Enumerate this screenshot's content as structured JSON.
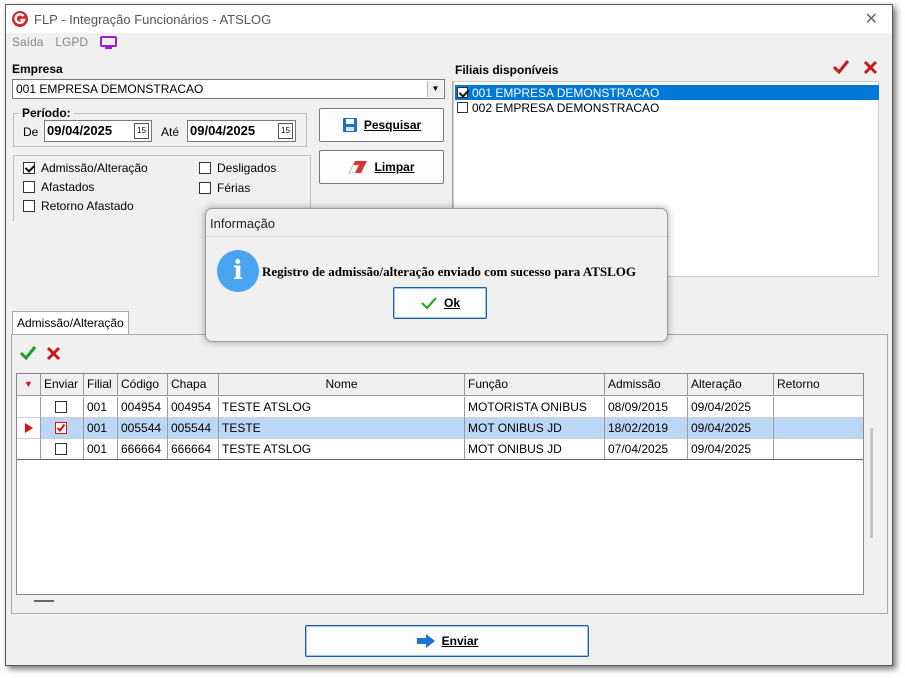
{
  "window": {
    "title": "FLP - Integração Funcionários - ATSLOG"
  },
  "menu": {
    "items": [
      "Saída",
      "LGPD"
    ]
  },
  "empresa": {
    "label": "Empresa",
    "value": "001 EMPRESA DEMONSTRACAO"
  },
  "periodo": {
    "label": "Período:",
    "de_label": "De",
    "de_value": "09/04/2025",
    "ate_label": "Até",
    "ate_value": "09/04/2025",
    "cal_glyph": "15"
  },
  "buttons": {
    "pesquisar": "Pesquisar",
    "limpar": "Limpar",
    "enviar": "Enviar"
  },
  "filters": [
    {
      "label": "Admissão/Alteração",
      "checked": true
    },
    {
      "label": "Afastados",
      "checked": false
    },
    {
      "label": "Retorno Afastado",
      "checked": false
    },
    {
      "label": "Desligados",
      "checked": false
    },
    {
      "label": "Férias",
      "checked": false
    }
  ],
  "filiais": {
    "label": "Filiais disponíveis",
    "items": [
      {
        "label": "001 EMPRESA DEMONSTRACAO",
        "checked": true,
        "selected": true
      },
      {
        "label": "002 EMPRESA DEMONSTRACAO",
        "checked": false,
        "selected": false
      }
    ]
  },
  "tab": {
    "label": "Admissão/Alteração"
  },
  "grid": {
    "columns": [
      "Enviar",
      "Filial",
      "Código",
      "Chapa",
      "Nome",
      "Função",
      "Admissão",
      "Alteração",
      "Retorno"
    ],
    "rows": [
      {
        "enviar": false,
        "filial": "001",
        "codigo": "004954",
        "chapa": "004954",
        "nome": "TESTE ATSLOG",
        "funcao": "MOTORISTA ONIBUS",
        "admissao": "08/09/2015",
        "alteracao": "09/04/2025",
        "retorno": ""
      },
      {
        "enviar": true,
        "filial": "001",
        "codigo": "005544",
        "chapa": "005544",
        "nome": "TESTE",
        "funcao": "MOT ONIBUS JD",
        "admissao": "18/02/2019",
        "alteracao": "09/04/2025",
        "retorno": ""
      },
      {
        "enviar": false,
        "filial": "001",
        "codigo": "666664",
        "chapa": "666664",
        "nome": "TESTE ATSLOG",
        "funcao": "MOT ONIBUS JD",
        "admissao": "07/04/2025",
        "alteracao": "09/04/2025",
        "retorno": ""
      }
    ]
  },
  "dialog": {
    "title": "Informação",
    "message": "Registro de admissão/alteração enviado com sucesso para ATSLOG",
    "ok_label": "Ok"
  },
  "colors": {
    "accent": "#0078d7",
    "selected_row": "#bcd7f5",
    "check_green": "#1e9e1e",
    "cross_red": "#c41a1a"
  }
}
